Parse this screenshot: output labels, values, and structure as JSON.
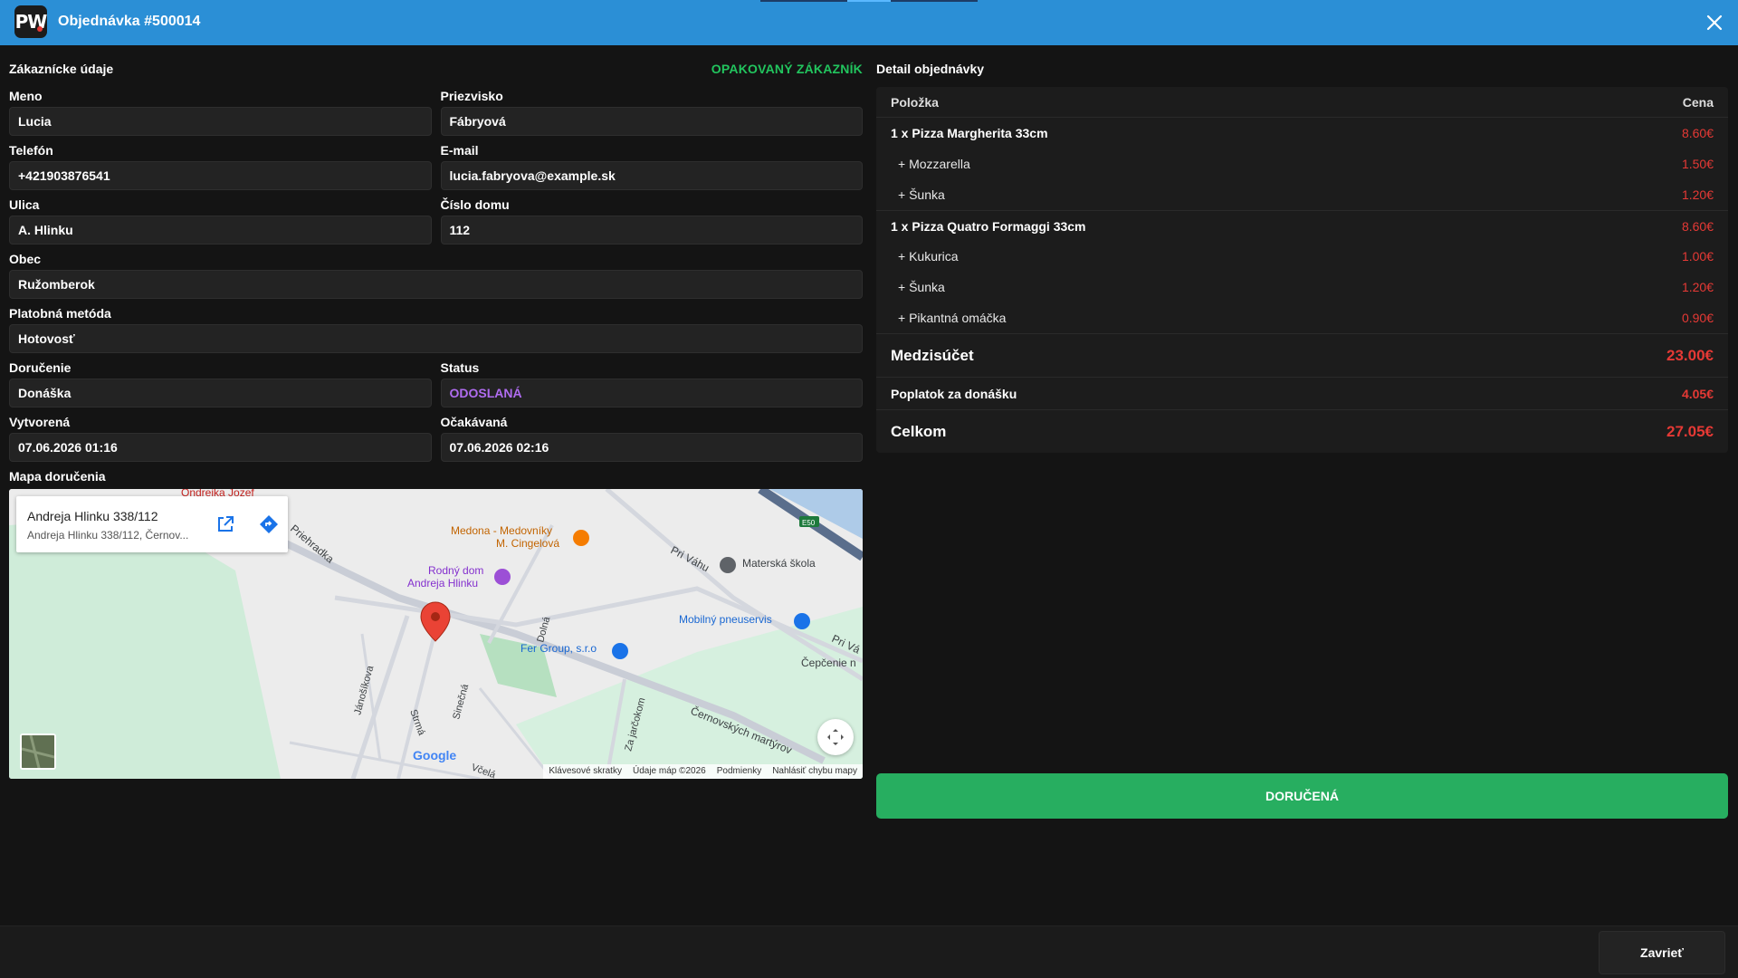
{
  "header": {
    "logo_text": "PW",
    "title": "Objednávka #500014",
    "close_icon": "close-icon"
  },
  "customer": {
    "section_title": "Zákaznícke údaje",
    "repeat_badge": "OPAKOVANÝ ZÁKAZNÍK",
    "first_name": {
      "label": "Meno",
      "value": "Lucia"
    },
    "last_name": {
      "label": "Priezvisko",
      "value": "Fábryová"
    },
    "phone": {
      "label": "Telefón",
      "value": "+421903876541"
    },
    "email": {
      "label": "E-mail",
      "value": "lucia.fabryova@example.sk"
    },
    "street": {
      "label": "Ulica",
      "value": "A. Hlinku"
    },
    "house_number": {
      "label": "Číslo domu",
      "value": "112"
    },
    "city": {
      "label": "Obec",
      "value": "Ružomberok"
    },
    "payment": {
      "label": "Platobná metóda",
      "value": "Hotovosť"
    },
    "delivery": {
      "label": "Doručenie",
      "value": "Donáška"
    },
    "status": {
      "label": "Status",
      "value": "ODOSLANÁ",
      "color": "#b06cf0"
    },
    "created": {
      "label": "Vytvorená",
      "value": "07.06.2026 01:16"
    },
    "expected": {
      "label": "Očakávaná",
      "value": "07.06.2026 02:16"
    }
  },
  "map": {
    "title": "Mapa doručenia",
    "place_name": "Andreja Hlinku 338/112",
    "place_address": "Andreja Hlinku 338/112, Černov...",
    "labels": {
      "ondrejka": "Ondrejka Jozef",
      "priehradka": "Priehradka",
      "medona1": "Medona - Medovníky",
      "medona2": "M. Cingelová",
      "rodny1": "Rodný dom",
      "rodny2": "Andreja Hlinku",
      "skola": "Materská škola",
      "pri_vahu": "Pri Váhu",
      "pri_vahu2": "Pri Vá",
      "pneuservis": "Mobilný pneuservis",
      "fer": "Fer Group, s.r.o",
      "cepcenie": "Čepčenie n",
      "dolna": "Dolná",
      "janosikova": "Jánošíkova",
      "strma": "Strmá",
      "sinecna": "Sinečná",
      "za_jarockom": "Za jarčokom",
      "cernovsky": "Černovských martýrov",
      "vcela": "Včelá",
      "e50": "E50"
    },
    "google": "Google",
    "footer": [
      "Klávesové skratky",
      "Údaje máp ©2026",
      "Podmienky",
      "Nahlásiť chybu mapy"
    ]
  },
  "order": {
    "section_title": "Detail objednávky",
    "col_item": "Položka",
    "col_price": "Cena",
    "items": [
      {
        "name": "1 x Pizza Margherita 33cm",
        "price": "8.60€",
        "extras": [
          {
            "name": "+ Mozzarella",
            "price": "1.50€"
          },
          {
            "name": "+ Šunka",
            "price": "1.20€"
          }
        ]
      },
      {
        "name": "1 x Pizza Quatro Formaggi 33cm",
        "price": "8.60€",
        "extras": [
          {
            "name": "+ Kukurica",
            "price": "1.00€"
          },
          {
            "name": "+ Šunka",
            "price": "1.20€"
          },
          {
            "name": "+ Pikantná omáčka",
            "price": "0.90€"
          }
        ]
      }
    ],
    "subtotal": {
      "label": "Medzisúčet",
      "value": "23.00€"
    },
    "fee": {
      "label": "Poplatok za donášku",
      "value": "4.05€"
    },
    "total": {
      "label": "Celkom",
      "value": "27.05€"
    },
    "price_color": "#e53935"
  },
  "actions": {
    "delivered": "DORUČENÁ",
    "close": "Zavrieť"
  },
  "colors": {
    "header": "#2b8fd6",
    "accent_green": "#27ae60",
    "repeat_green": "#22c55e"
  }
}
